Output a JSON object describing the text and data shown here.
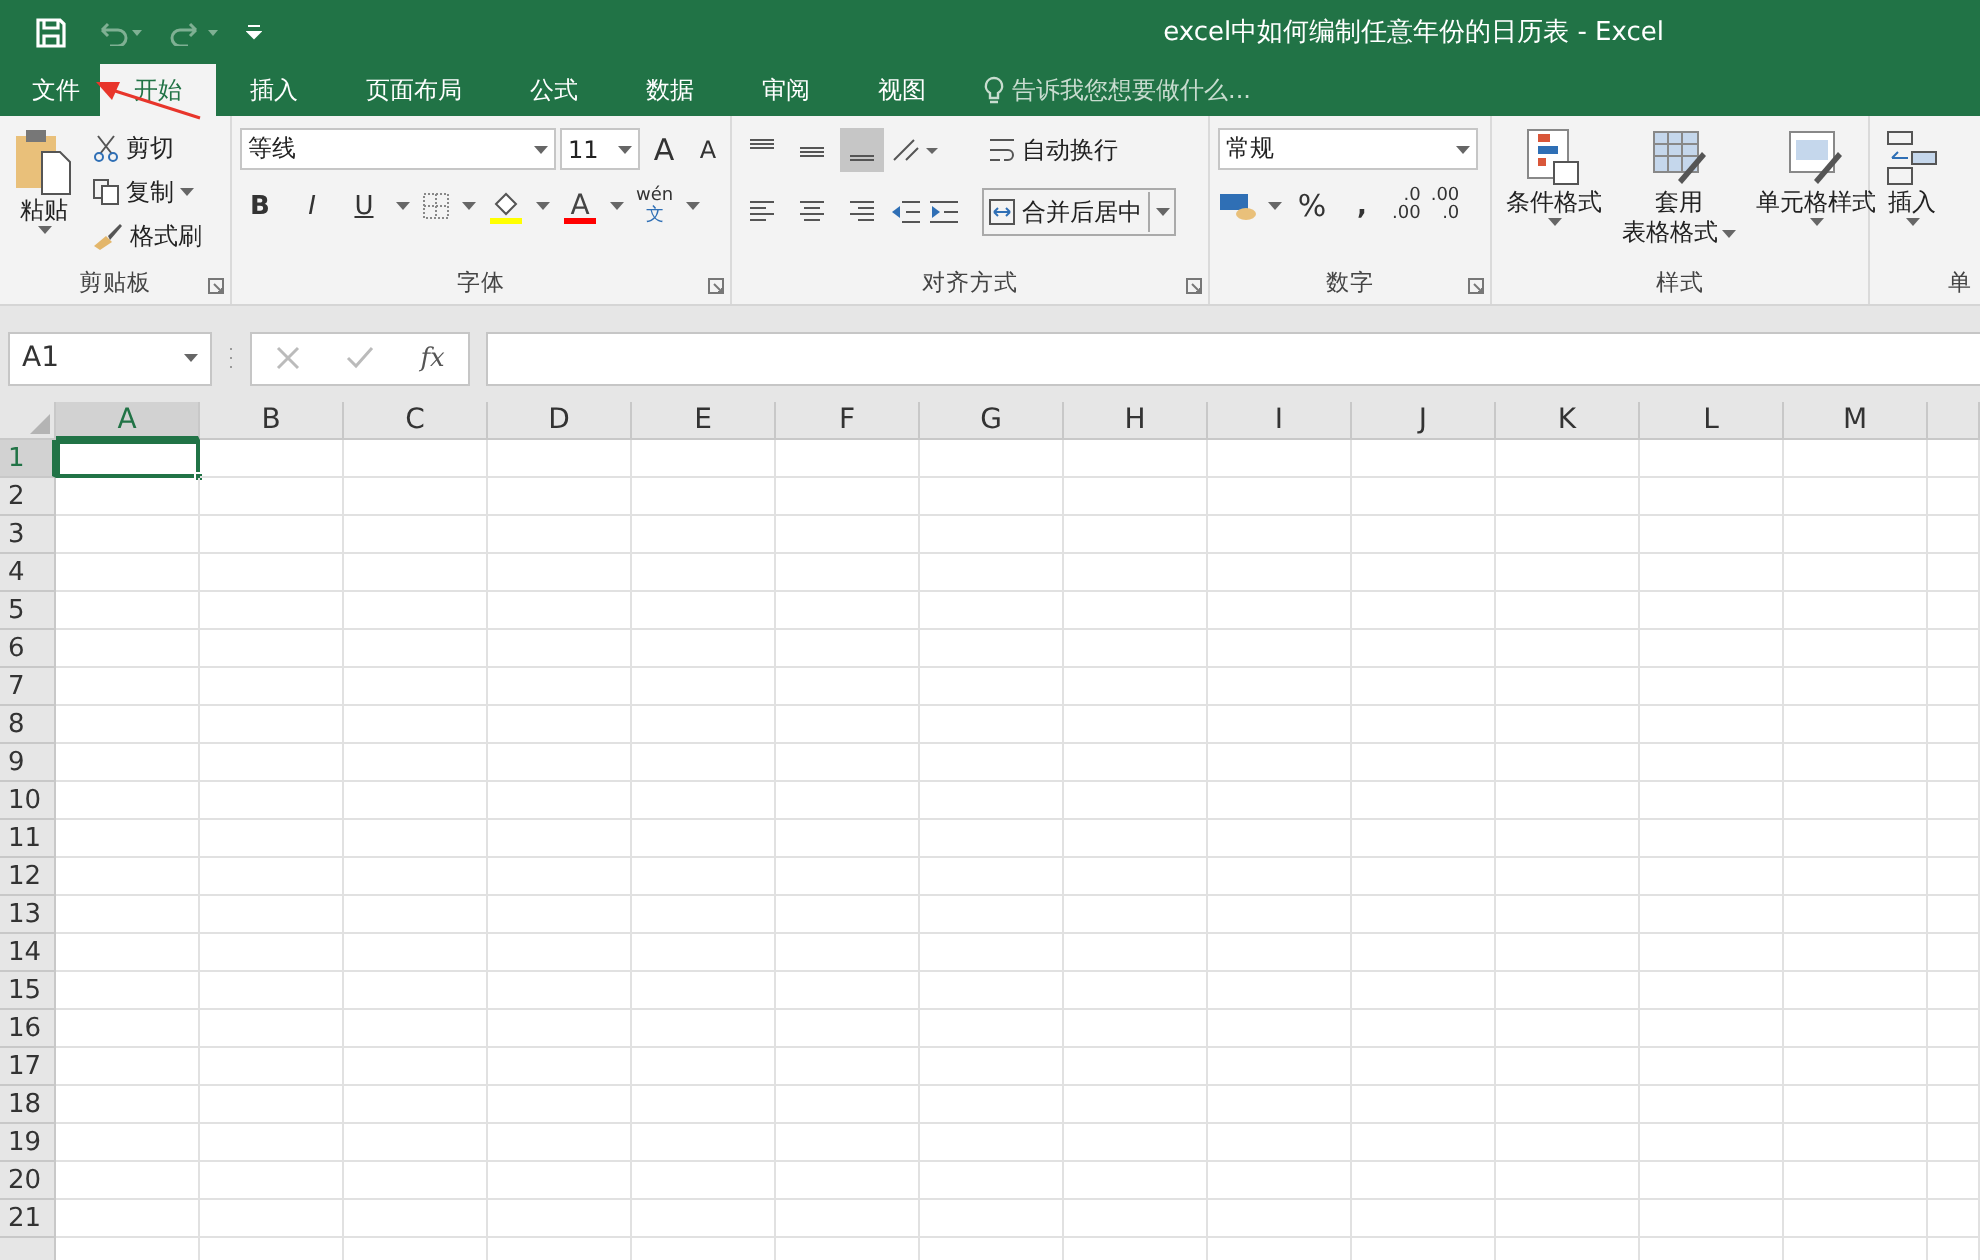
{
  "window": {
    "title": "excel中如何编制任意年份的日历表 - Excel"
  },
  "tabs": [
    {
      "label": "文件",
      "selected": false,
      "kind": "file"
    },
    {
      "label": "开始",
      "selected": true,
      "kind": "tab"
    },
    {
      "label": "插入",
      "selected": false,
      "kind": "tab"
    },
    {
      "label": "页面布局",
      "selected": false,
      "kind": "tab"
    },
    {
      "label": "公式",
      "selected": false,
      "kind": "tab"
    },
    {
      "label": "数据",
      "selected": false,
      "kind": "tab"
    },
    {
      "label": "审阅",
      "selected": false,
      "kind": "tab"
    },
    {
      "label": "视图",
      "selected": false,
      "kind": "tab"
    }
  ],
  "tell_me": {
    "placeholder": "告诉我您想要做什么..."
  },
  "ribbon": {
    "clipboard": {
      "paste": "粘贴",
      "cut": "剪切",
      "copy": "复制",
      "format_painter": "格式刷",
      "label": "剪贴板"
    },
    "font": {
      "font_name": "等线",
      "font_size": "11",
      "grow": "A",
      "shrink": "A",
      "bold": "B",
      "italic": "I",
      "underline": "U",
      "font_color": "A",
      "phonetic": [
        "wén",
        "文"
      ],
      "label": "字体"
    },
    "alignment": {
      "wrap_text": "自动换行",
      "merge_center": "合并后居中",
      "label": "对齐方式"
    },
    "number": {
      "format": "常规",
      "percent": "%",
      "comma": ",",
      "increase_decimal": [
        ".0",
        ".00"
      ],
      "decrease_decimal": [
        ".00",
        ".0"
      ],
      "label": "数字"
    },
    "styles": {
      "conditional": "条件格式",
      "table": [
        "套用",
        "表格格式"
      ],
      "cell_styles": "单元格样式",
      "label": "样式"
    },
    "cells": {
      "insert": "插入",
      "label": "单"
    }
  },
  "formula_bar": {
    "name_box": "A1",
    "fx": "fx"
  },
  "sheet": {
    "columns": [
      {
        "label": "A",
        "selected": true
      },
      {
        "label": "B",
        "selected": false
      },
      {
        "label": "C",
        "selected": false
      },
      {
        "label": "D",
        "selected": false
      },
      {
        "label": "E",
        "selected": false
      },
      {
        "label": "F",
        "selected": false
      },
      {
        "label": "G",
        "selected": false
      },
      {
        "label": "H",
        "selected": false
      },
      {
        "label": "I",
        "selected": false
      },
      {
        "label": "J",
        "selected": false
      },
      {
        "label": "K",
        "selected": false
      },
      {
        "label": "L",
        "selected": false
      },
      {
        "label": "M",
        "selected": false
      }
    ],
    "rows": [
      {
        "label": "1",
        "selected": true
      },
      {
        "label": "2",
        "selected": false
      },
      {
        "label": "3",
        "selected": false
      },
      {
        "label": "4",
        "selected": false
      },
      {
        "label": "5",
        "selected": false
      },
      {
        "label": "6",
        "selected": false
      },
      {
        "label": "7",
        "selected": false
      },
      {
        "label": "8",
        "selected": false
      },
      {
        "label": "9",
        "selected": false
      },
      {
        "label": "10",
        "selected": false
      },
      {
        "label": "11",
        "selected": false
      },
      {
        "label": "12",
        "selected": false
      },
      {
        "label": "13",
        "selected": false
      },
      {
        "label": "14",
        "selected": false
      },
      {
        "label": "15",
        "selected": false
      },
      {
        "label": "16",
        "selected": false
      },
      {
        "label": "17",
        "selected": false
      },
      {
        "label": "18",
        "selected": false
      },
      {
        "label": "19",
        "selected": false
      },
      {
        "label": "20",
        "selected": false
      },
      {
        "label": "21",
        "selected": false
      }
    ]
  }
}
